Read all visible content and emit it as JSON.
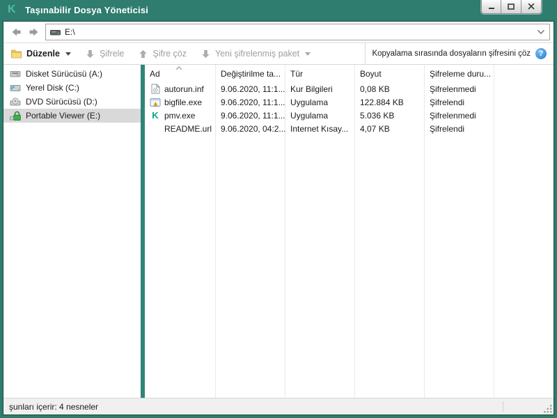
{
  "window": {
    "title": "Taşınabilir Dosya Yöneticisi"
  },
  "navbar": {
    "address": "E:\\"
  },
  "toolbar": {
    "edit_label": "Düzenle",
    "encrypt_label": "Şifrele",
    "decrypt_label": "Şifre çöz",
    "new_package_label": "Yeni şifrelenmiş paket",
    "copy_decrypt_label": "Kopyalama sırasında dosyaların şifresini çöz",
    "help_glyph": "?"
  },
  "sidebar": {
    "selected_index": 3,
    "items": [
      {
        "label": "Disket Sürücüsü (A:)",
        "icon": "floppy-drive-icon"
      },
      {
        "label": "Yerel Disk (C:)",
        "icon": "hard-disk-icon"
      },
      {
        "label": "DVD Sürücüsü (D:)",
        "icon": "dvd-drive-icon"
      },
      {
        "label": "Portable Viewer (E:)",
        "icon": "encrypted-drive-icon"
      }
    ]
  },
  "filelist": {
    "columns": {
      "name": "Ad",
      "modified": "Değiştirilme ta...",
      "type": "Tür",
      "size": "Boyut",
      "encryption": "Şifreleme duru..."
    },
    "rows": [
      {
        "name": "autorun.inf",
        "modified": "9.06.2020, 11:1...",
        "type": "Kur Bilgileri",
        "size": "0,08 KB",
        "encryption": "Şifrelenmedi",
        "icon": "setup-info-icon"
      },
      {
        "name": "bigfile.exe",
        "modified": "9.06.2020, 11:1...",
        "type": "Uygulama",
        "size": "122.884 KB",
        "encryption": "Şifrelendi",
        "icon": "application-icon"
      },
      {
        "name": "pmv.exe",
        "modified": "9.06.2020, 11:1...",
        "type": "Uygulama",
        "size": "5.036 KB",
        "encryption": "Şifrelenmedi",
        "icon": "kaspersky-app-icon"
      },
      {
        "name": "README.url",
        "modified": "9.06.2020, 04:2...",
        "type": "Internet Kısay...",
        "size": "4,07 KB",
        "encryption": "Şifrelendi",
        "icon": "none"
      }
    ]
  },
  "statusbar": {
    "text": "şunları içerir: 4 nesneler"
  },
  "icons": {
    "kaspersky_glyph": "K"
  },
  "colors": {
    "titlebar": "#2e7d6e",
    "splitter": "#2e8577",
    "kaspersky_green": "#4cbfa2",
    "kaspersky_app_green": "#00a88e",
    "selection": "#d9d9d9",
    "disabled_text": "#9e9e9e",
    "help_icon_blue": "#3d8fd6"
  }
}
